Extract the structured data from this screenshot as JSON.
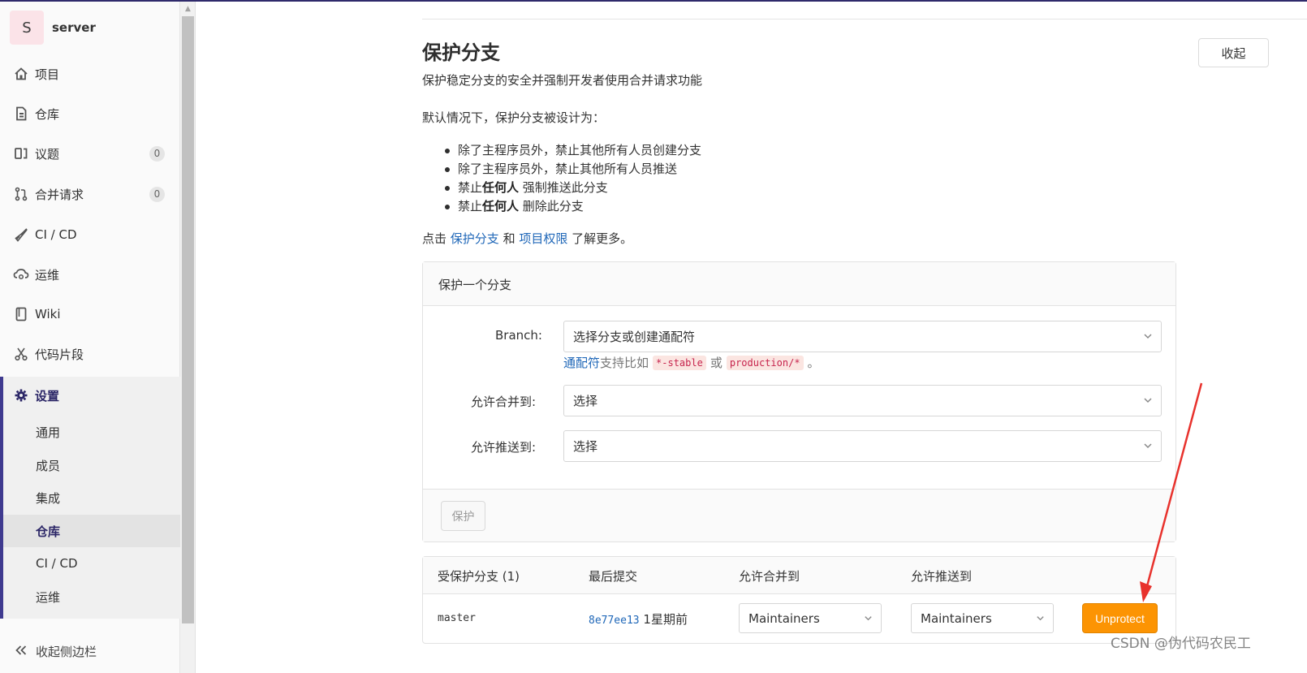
{
  "project": {
    "avatar_letter": "S",
    "name": "server"
  },
  "sidebar": {
    "items": [
      {
        "label": "项目",
        "icon": "home-icon"
      },
      {
        "label": "仓库",
        "icon": "doc-icon"
      },
      {
        "label": "议题",
        "icon": "issues-icon",
        "badge": "0"
      },
      {
        "label": "合并请求",
        "icon": "merge-request-icon",
        "badge": "0"
      },
      {
        "label": "CI / CD",
        "icon": "rocket-icon"
      },
      {
        "label": "运维",
        "icon": "cloud-gear-icon"
      },
      {
        "label": "Wiki",
        "icon": "book-icon"
      },
      {
        "label": "代码片段",
        "icon": "scissors-icon"
      },
      {
        "label": "设置",
        "icon": "gear-icon"
      }
    ],
    "settings_sub": [
      "通用",
      "成员",
      "集成",
      "仓库",
      "CI / CD",
      "运维"
    ],
    "active_item": "设置",
    "active_sub": "仓库",
    "collapse_label": "收起侧边栏"
  },
  "section": {
    "title": "保护分支",
    "collapse_button": "收起",
    "description": "保护稳定分支的安全并强制开发者使用合并请求功能",
    "default_text": "默认情况下，保护分支被设计为：",
    "bullets": [
      {
        "pre": "除了主程序员外，禁止其他所有人员创建分支",
        "bold": "",
        "post": ""
      },
      {
        "pre": "除了主程序员外，禁止其他所有人员推送",
        "bold": "",
        "post": ""
      },
      {
        "pre": "禁止",
        "bold": "任何人",
        "post": " 强制推送此分支"
      },
      {
        "pre": "禁止",
        "bold": "任何人",
        "post": " 删除此分支"
      }
    ],
    "more_prefix": "点击 ",
    "more_link1": "保护分支",
    "more_mid": " 和 ",
    "more_link2": "项目权限",
    "more_suffix": " 了解更多。"
  },
  "protect_form": {
    "header": "保护一个分支",
    "branch_label": "Branch:",
    "branch_placeholder": "选择分支或创建通配符",
    "hint_link": "通配符",
    "hint_text": " 支持比如",
    "hint_code1": "*-stable",
    "hint_or": "或",
    "hint_code2": "production/*",
    "hint_end": "。",
    "merge_label": "允许合并到:",
    "merge_value": "选择",
    "push_label": "允许推送到:",
    "push_value": "选择",
    "protect_button": "保护"
  },
  "protected_table": {
    "headers": [
      "受保护分支 (1)",
      "最后提交",
      "允许合并到",
      "允许推送到"
    ],
    "rows": [
      {
        "branch": "master",
        "sha": "8e77ee13",
        "time": "1星期前",
        "merge": "Maintainers",
        "push": "Maintainers",
        "action": "Unprotect"
      }
    ]
  },
  "colors": {
    "accent": "#3f3a8f",
    "link": "#1f67b8",
    "unprotect": "#fc9403",
    "arrow": "#e8322d"
  },
  "watermark": "CSDN @伪代码农民工"
}
